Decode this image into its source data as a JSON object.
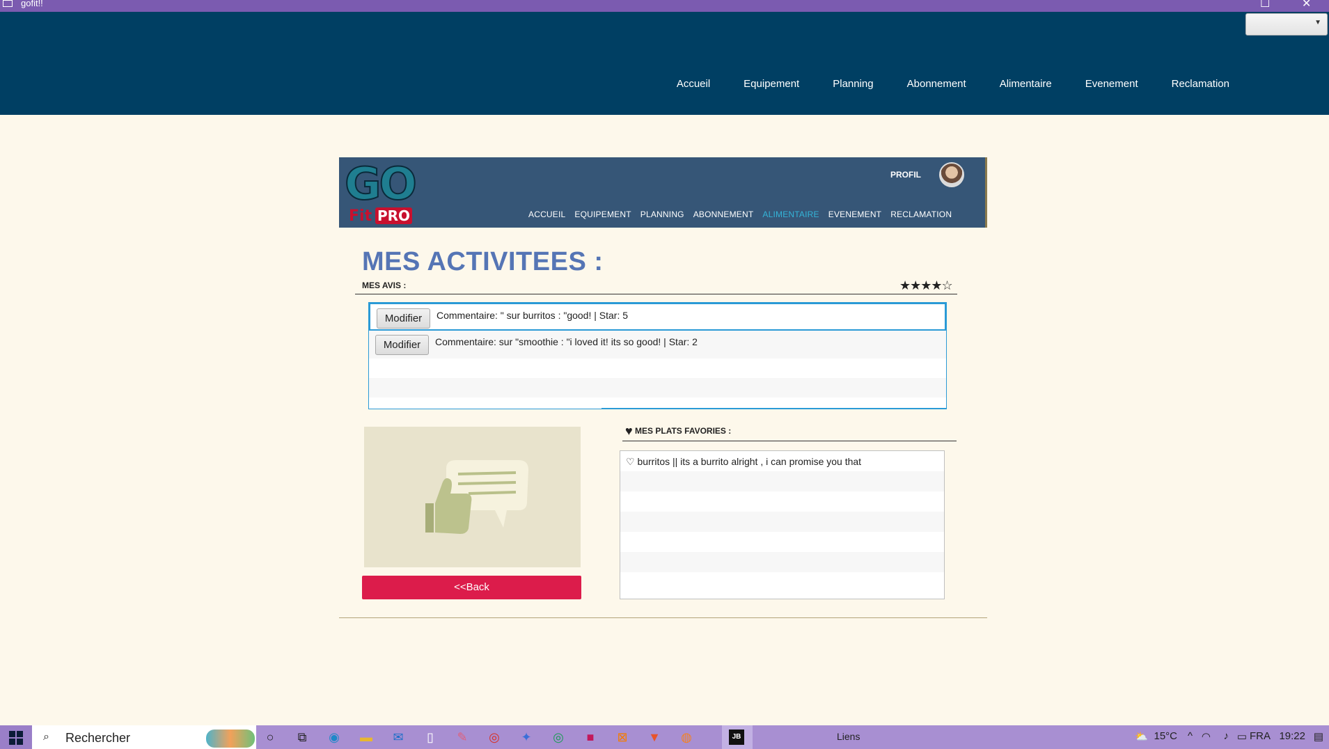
{
  "window": {
    "title": "gofit!!",
    "controls": [
      "maximize-icon",
      "close-icon"
    ]
  },
  "app_nav": {
    "dropdown_value": "",
    "items": [
      "Accueil",
      "Equipement",
      "Planning",
      "Abonnement",
      "Alimentaire",
      "Evenement",
      "Reclamation"
    ]
  },
  "site": {
    "logo_text": {
      "go": "GO",
      "fit": "Fit",
      "pro": "PRO"
    },
    "profil_label": "PROFIL",
    "menu": [
      "ACCUEIL",
      "EQUIPEMENT",
      "PLANNING",
      "ABONNEMENT",
      "ALIMENTAIRE",
      "EVENEMENT",
      "RECLAMATION"
    ],
    "active_menu": "ALIMENTAIRE",
    "accent_color": "#34b4d8"
  },
  "main": {
    "title": "MES ACTIVITEES :",
    "avis_label": "MES AVIS :",
    "rating": {
      "stars": "★★★★☆",
      "value": 4,
      "max": 5
    },
    "avis": [
      {
        "button": "Modifier",
        "text": "Commentaire: \" sur burritos : \"good! | Star: 5",
        "selected": true
      },
      {
        "button": "Modifier",
        "text": "Commentaire:  sur \"smoothie : \"i loved it! its so good! | Star: 2",
        "selected": false
      }
    ],
    "back_label": "<<Back",
    "favoris_heart": "♥",
    "favoris_label": "MES PLATS FAVORIES :",
    "favoris": [
      "♡ burritos || its a burrito alright , i can promise you that"
    ],
    "back_color": "#dc1c4b"
  },
  "taskbar": {
    "search_label": "Rechercher",
    "liens": "Liens",
    "temperature": "15°C",
    "language": "FRA",
    "time": "19:22"
  }
}
